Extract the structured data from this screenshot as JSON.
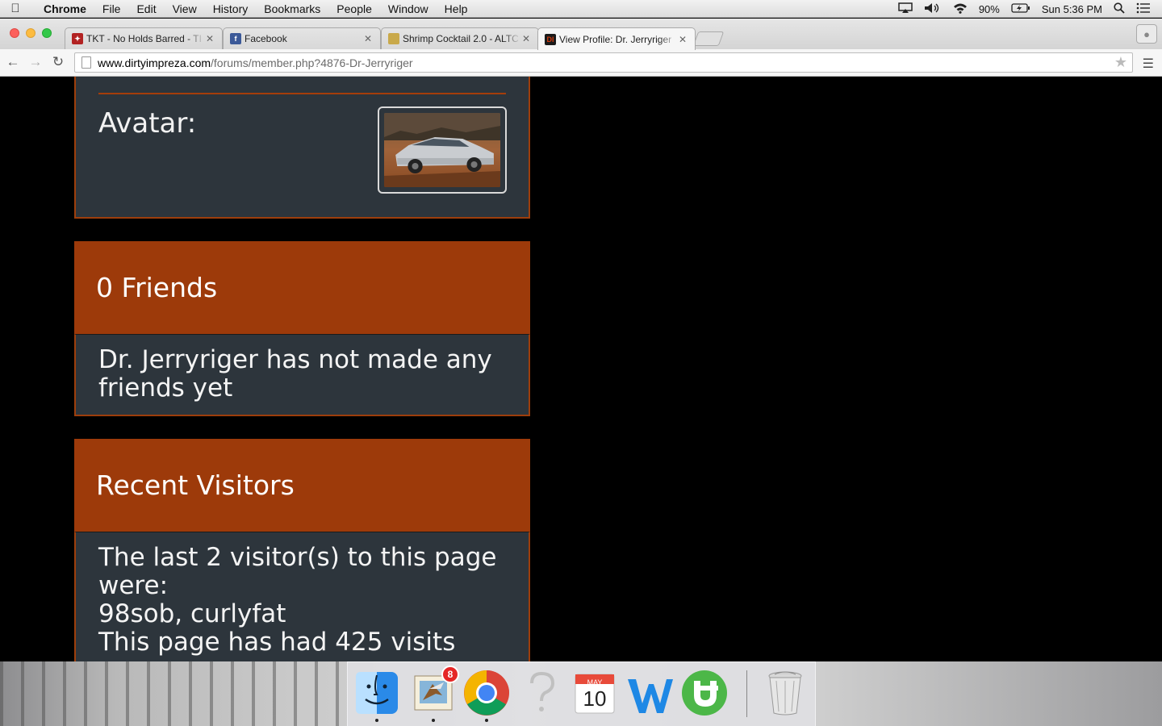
{
  "menubar": {
    "app_name": "Chrome",
    "items": [
      "File",
      "Edit",
      "View",
      "History",
      "Bookmarks",
      "People",
      "Window",
      "Help"
    ],
    "battery": "90%",
    "clock": "Sun 5:36 PM"
  },
  "tabs": [
    {
      "title": "TKT - No Holds Barred - TI",
      "active": false
    },
    {
      "title": "Facebook",
      "active": false
    },
    {
      "title": "Shrimp Cocktail 2.0 - ALTC",
      "active": false
    },
    {
      "title": "View Profile: Dr. Jerryriger",
      "active": true
    }
  ],
  "address_bar": {
    "host": "www.dirtyimpreza.com",
    "path": "/forums/member.php?4876-Dr-Jerryriger"
  },
  "page": {
    "avatar_label": "Avatar:",
    "friends": {
      "heading": "0 Friends",
      "message": "Dr. Jerryriger has not made any friends yet"
    },
    "recent_visitors": {
      "heading": "Recent Visitors",
      "intro": "The last 2 visitor(s) to this page were:",
      "visitors": "98sob, curlyfat",
      "total": "This page has had 425 visits"
    }
  },
  "dock": {
    "items": [
      "finder",
      "mail",
      "chrome",
      "unknown-app",
      "calendar",
      "word",
      "utorrent",
      "trash"
    ],
    "mail_badge": "8",
    "calendar_month": "MAY",
    "calendar_day": "10"
  },
  "colors": {
    "panel_orange": "#9d3a0a",
    "panel_body": "#2d353c"
  }
}
